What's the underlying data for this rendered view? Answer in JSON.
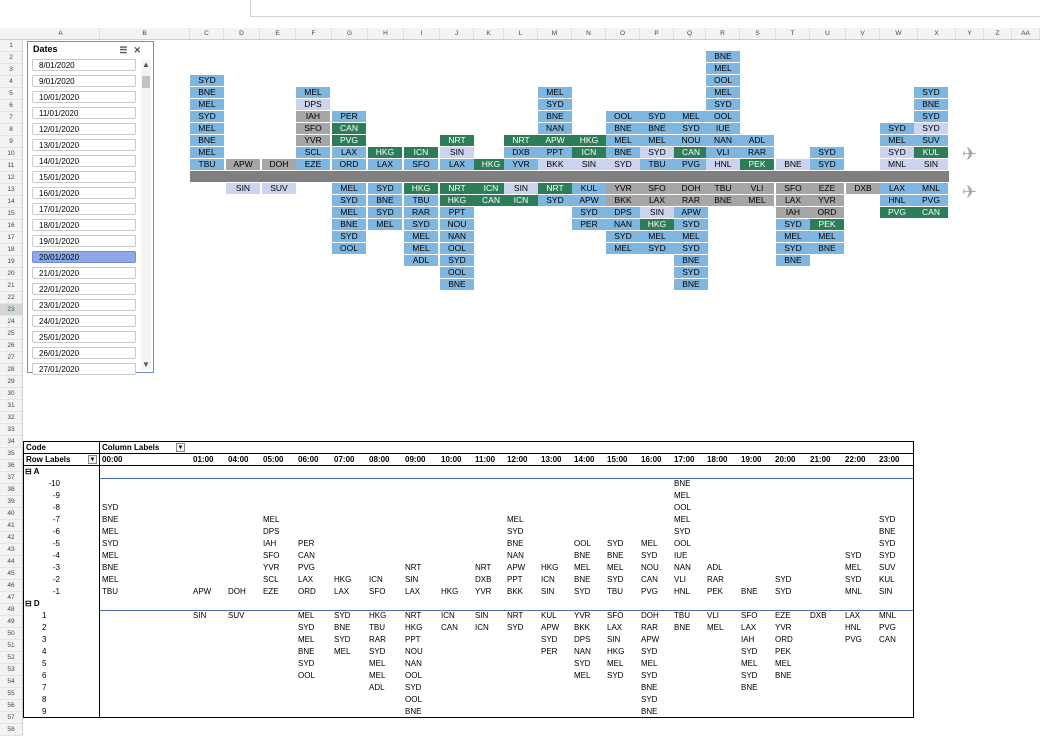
{
  "columns": [
    "A",
    "B",
    "C",
    "D",
    "E",
    "F",
    "G",
    "H",
    "I",
    "J",
    "K",
    "L",
    "M",
    "N",
    "O",
    "P",
    "Q",
    "R",
    "S",
    "T",
    "U",
    "V",
    "W",
    "X",
    "Y",
    "Z",
    "AA"
  ],
  "selected_row": "23",
  "slicer": {
    "title": "Dates",
    "items": [
      "8/01/2020",
      "9/01/2020",
      "10/01/2020",
      "11/01/2020",
      "12/01/2020",
      "13/01/2020",
      "14/01/2020",
      "15/01/2020",
      "16/01/2020",
      "17/01/2020",
      "18/01/2020",
      "19/01/2020",
      "20/01/2020",
      "21/01/2020",
      "22/01/2020",
      "23/01/2020",
      "24/01/2020",
      "25/01/2020",
      "26/01/2020",
      "27/01/2020"
    ],
    "selected": "20/01/2020"
  },
  "colors": {
    "arrival": "#7fb6df",
    "highlight": "#2e7d59",
    "alt": "#a6a6a6",
    "light": "#ccd3ee",
    "hour_bar": "#7f7f7f"
  },
  "hours_short": [
    "0000",
    "0100",
    "0400",
    "0500",
    "0600",
    "0700",
    "0800",
    "0900",
    "1000",
    "1100",
    "1200",
    "1300",
    "1400",
    "1500",
    "1600",
    "1700",
    "1800",
    "1900",
    "2000",
    "2100",
    "2200",
    "2300"
  ],
  "hours_long": [
    "00:00",
    "01:00",
    "04:00",
    "05:00",
    "06:00",
    "07:00",
    "08:00",
    "09:00",
    "10:00",
    "11:00",
    "12:00",
    "13:00",
    "14:00",
    "15:00",
    "16:00",
    "17:00",
    "18:00",
    "19:00",
    "20:00",
    "21:00",
    "22:00",
    "23:00"
  ],
  "chart_top": [
    [
      "SYD",
      "BNE",
      "MEL",
      "SYD",
      "MEL",
      "BNE",
      "MEL",
      "TBU"
    ],
    [
      "APW"
    ],
    [
      "DOH"
    ],
    [
      "MEL",
      "DPS",
      "IAH",
      "SFO",
      "YVR",
      "SCL",
      "EZE"
    ],
    [
      "PER",
      "CAN",
      "PVG",
      "LAX",
      "ORD"
    ],
    [
      "HKG",
      "LAX"
    ],
    [
      "ICN",
      "SFO"
    ],
    [
      "NRT",
      "SIN",
      "LAX"
    ],
    [
      "HKG"
    ],
    [
      "NRT",
      "DXB",
      "YVR"
    ],
    [
      "MEL",
      "SYD",
      "BNE",
      "NAN",
      "APW",
      "PPT",
      "BKK"
    ],
    [
      "HKG",
      "ICN",
      "SIN"
    ],
    [
      "OOL",
      "BNE",
      "MEL",
      "BNE",
      "SYD"
    ],
    [
      "SYD",
      "BNE",
      "MEL",
      "SYD",
      "TBU"
    ],
    [
      "MEL",
      "SYD",
      "NOU",
      "CAN",
      "PVG"
    ],
    [
      "BNE",
      "MEL",
      "OOL",
      "MEL",
      "SYD",
      "OOL",
      "IUE",
      "NAN",
      "VLI",
      "HNL"
    ],
    [
      "ADL",
      "RAR",
      "PEK"
    ],
    [
      "BNE"
    ],
    [
      "SYD",
      "SYD"
    ],
    [],
    [
      "SYD",
      "MEL",
      "SYD",
      "MNL"
    ],
    [
      "SYD",
      "BNE",
      "SYD",
      "SYD",
      "SUV",
      "KUL",
      "SIN"
    ]
  ],
  "chart_bottom": [
    [],
    [
      "SIN"
    ],
    [
      "SUV"
    ],
    [],
    [
      "MEL",
      "SYD",
      "MEL",
      "BNE",
      "SYD",
      "OOL"
    ],
    [
      "SYD",
      "BNE",
      "SYD",
      "MEL"
    ],
    [
      "HKG",
      "TBU",
      "RAR",
      "SYD",
      "MEL",
      "MEL",
      "ADL"
    ],
    [
      "NRT",
      "HKG",
      "PPT",
      "NOU",
      "NAN",
      "OOL",
      "SYD",
      "OOL",
      "BNE"
    ],
    [
      "ICN",
      "CAN"
    ],
    [
      "SIN",
      "ICN"
    ],
    [
      "NRT",
      "SYD"
    ],
    [
      "KUL",
      "APW",
      "SYD",
      "PER"
    ],
    [
      "YVR",
      "BKK",
      "DPS",
      "NAN",
      "SYD",
      "MEL"
    ],
    [
      "SFO",
      "LAX",
      "SIN",
      "HKG",
      "MEL",
      "SYD"
    ],
    [
      "DOH",
      "RAR",
      "APW",
      "SYD",
      "MEL",
      "SYD",
      "BNE",
      "SYD",
      "BNE"
    ],
    [
      "TBU",
      "BNE"
    ],
    [
      "VLI",
      "MEL"
    ],
    [
      "SFO",
      "LAX",
      "IAH",
      "SYD",
      "MEL",
      "SYD",
      "BNE"
    ],
    [
      "EZE",
      "YVR",
      "ORD",
      "PEK",
      "MEL",
      "BNE"
    ],
    [
      "DXB"
    ],
    [
      "LAX",
      "HNL",
      "PVG"
    ],
    [
      "MNL",
      "PVG",
      "CAN"
    ]
  ],
  "pivot": {
    "code_label": "Code",
    "column_labels": "Column Labels",
    "row_labels": "Row Labels",
    "group_a": "A",
    "group_d": "D",
    "a_rows": [
      "-10",
      "-9",
      "-8",
      "-7",
      "-6",
      "-5",
      "-4",
      "-3",
      "-2",
      "-1"
    ],
    "d_rows": [
      "1",
      "2",
      "3",
      "4",
      "5",
      "6",
      "7",
      "8",
      "9"
    ]
  }
}
